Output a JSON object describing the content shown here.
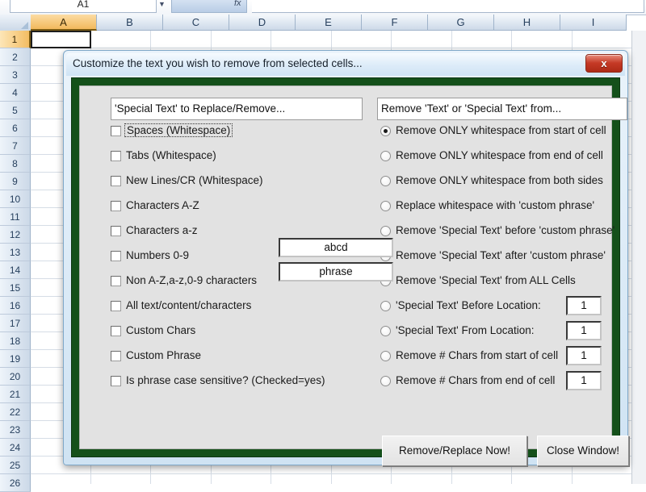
{
  "excel": {
    "name_box": "A1",
    "fx_label": "fx",
    "columns": [
      "A",
      "B",
      "C",
      "D",
      "E",
      "F",
      "G",
      "H",
      "I"
    ],
    "selected_column": "A",
    "rows": [
      "1",
      "2",
      "3",
      "4",
      "5",
      "6",
      "7",
      "8",
      "9",
      "10",
      "11",
      "12",
      "13",
      "14",
      "15",
      "16",
      "17",
      "18",
      "19",
      "20",
      "21",
      "22",
      "23",
      "24",
      "25",
      "26"
    ],
    "selected_row": "1",
    "active_cell": "A1"
  },
  "dialog": {
    "title": "Customize the text you wish to remove from selected cells...",
    "close_button": "x",
    "frame_color": "#14501a",
    "fields": {
      "left": "'Special Text' to Replace/Remove...",
      "right": "Remove 'Text' or  'Special Text' from..."
    },
    "checkboxes": [
      {
        "label": "Spaces (Whitespace)",
        "checked": false,
        "focused": true
      },
      {
        "label": "Tabs (Whitespace)",
        "checked": false,
        "focused": false
      },
      {
        "label": "New Lines/CR (Whitespace)",
        "checked": false,
        "focused": false
      },
      {
        "label": "Characters A-Z",
        "checked": false,
        "focused": false
      },
      {
        "label": "Characters a-z",
        "checked": false,
        "focused": false
      },
      {
        "label": "Numbers 0-9",
        "checked": false,
        "focused": false
      },
      {
        "label": "Non A-Z,a-z,0-9 characters",
        "checked": false,
        "focused": false
      },
      {
        "label": "All text/content/characters",
        "checked": false,
        "focused": false
      },
      {
        "label": "Custom Chars",
        "checked": false,
        "focused": false
      },
      {
        "label": "Custom Phrase",
        "checked": false,
        "focused": false
      },
      {
        "label": "Is phrase case sensitive? (Checked=yes)",
        "checked": false,
        "focused": false
      }
    ],
    "custom_chars_value": "abcd",
    "custom_phrase_value": "phrase",
    "radios": [
      {
        "label": "Remove ONLY whitespace from start of cell",
        "selected": true
      },
      {
        "label": "Remove ONLY whitespace from end of cell",
        "selected": false
      },
      {
        "label": "Remove ONLY whitespace from both sides",
        "selected": false
      },
      {
        "label": "Replace whitespace with 'custom phrase'",
        "selected": false
      },
      {
        "label": "Remove 'Special Text' before 'custom phrase'",
        "selected": false
      },
      {
        "label": "Remove 'Special Text' after 'custom phrase'",
        "selected": false
      },
      {
        "label": "Remove 'Special Text' from ALL Cells",
        "selected": false
      },
      {
        "label": "'Special Text' Before Location:",
        "selected": false,
        "value": "1"
      },
      {
        "label": "'Special Text' From Location:",
        "selected": false,
        "value": "1"
      },
      {
        "label": "Remove # Chars from start of cell",
        "selected": false,
        "value": "1"
      },
      {
        "label": "Remove # Chars from end of cell",
        "selected": false,
        "value": "1"
      }
    ],
    "buttons": {
      "remove": "Remove/Replace Now!",
      "close": "Close Window!"
    }
  }
}
